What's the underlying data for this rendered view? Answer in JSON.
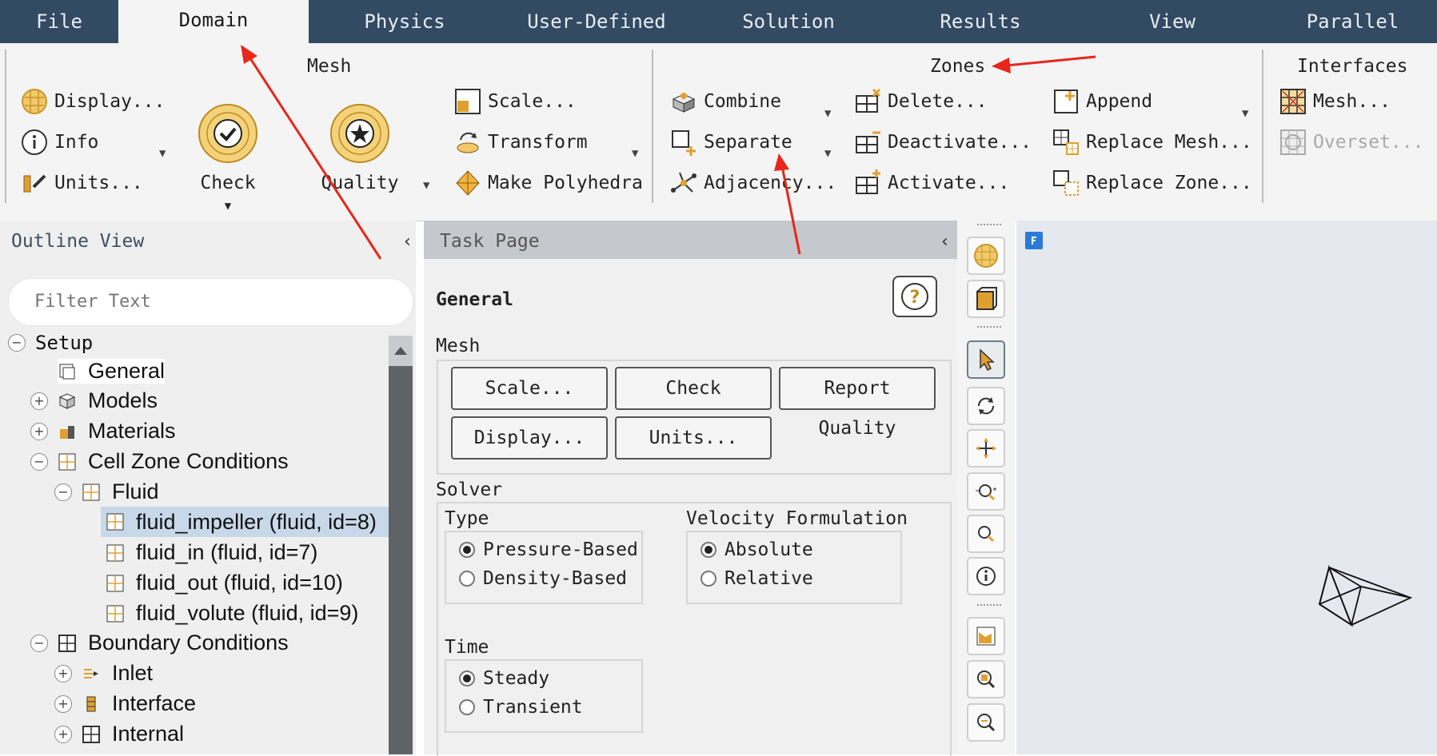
{
  "menu": {
    "items": [
      "File",
      "Domain",
      "Physics",
      "User-Defined",
      "Solution",
      "Results",
      "View",
      "Parallel"
    ],
    "active": "Domain"
  },
  "ribbon": {
    "mesh": {
      "title": "Mesh",
      "display": "Display...",
      "info": "Info",
      "units": "Units...",
      "check": "Check",
      "quality": "Quality",
      "scale": "Scale...",
      "transform": "Transform",
      "make_polyhedra": "Make Polyhedra"
    },
    "zones": {
      "title": "Zones",
      "combine": "Combine",
      "separate": "Separate",
      "adjacency": "Adjacency...",
      "delete": "Delete...",
      "deactivate": "Deactivate...",
      "activate": "Activate...",
      "append": "Append",
      "replace_mesh": "Replace Mesh...",
      "replace_zone": "Replace Zone..."
    },
    "interfaces": {
      "title": "Interfaces",
      "mesh": "Mesh...",
      "overset": "Overset..."
    }
  },
  "outline": {
    "title": "Outline View",
    "filter_placeholder": "Filter Text",
    "tree": {
      "setup": "Setup",
      "general": "General",
      "models": "Models",
      "materials": "Materials",
      "cell_zone_conditions": "Cell Zone Conditions",
      "fluid": "Fluid",
      "fluid_impeller": "fluid_impeller (fluid, id=8)",
      "fluid_in": "fluid_in (fluid, id=7)",
      "fluid_out": "fluid_out (fluid, id=10)",
      "fluid_volute": "fluid_volute (fluid, id=9)",
      "boundary_conditions": "Boundary Conditions",
      "inlet": "Inlet",
      "interface": "Interface",
      "internal": "Internal"
    }
  },
  "task": {
    "title": "Task Page",
    "page": "General",
    "mesh_label": "Mesh",
    "buttons": {
      "scale": "Scale...",
      "check": "Check",
      "report_quality": "Report Quality",
      "display": "Display...",
      "units": "Units..."
    },
    "solver_label": "Solver",
    "type_label": "Type",
    "type_options": [
      "Pressure-Based",
      "Density-Based"
    ],
    "type_selected": "Pressure-Based",
    "velocity_label": "Velocity Formulation",
    "velocity_options": [
      "Absolute",
      "Relative"
    ],
    "velocity_selected": "Absolute",
    "time_label": "Time",
    "time_options": [
      "Steady",
      "Transient"
    ],
    "time_selected": "Steady"
  },
  "colors": {
    "menubar": "#334a63",
    "accent_arrow": "#e8261c",
    "selected_row": "#c8d8e8"
  }
}
